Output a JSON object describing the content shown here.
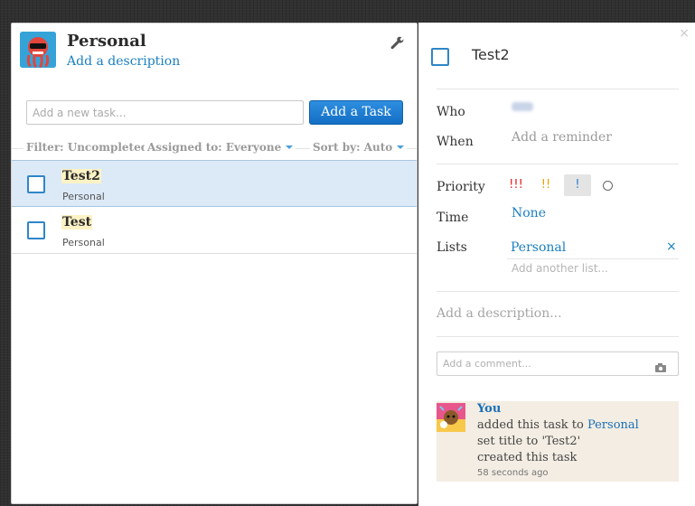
{
  "list": {
    "title": "Personal",
    "description_link": "Add a description",
    "new_task_placeholder": "Add a new task...",
    "add_task_label": "Add a Task"
  },
  "filters": {
    "filter": "Filter: Uncompleted",
    "assigned": "Assigned to: Everyone",
    "sort": "Sort by: Auto"
  },
  "tasks": [
    {
      "title": "Test2",
      "list": "Personal",
      "selected": true
    },
    {
      "title": "Test",
      "list": "Personal",
      "selected": false
    }
  ],
  "detail": {
    "title": "Test2",
    "close": "×",
    "who_label": "Who",
    "when_label": "When",
    "when_value": "Add a reminder",
    "priority_label": "Priority",
    "priority_options": [
      "!!!",
      "!!",
      "!"
    ],
    "priority_selected": "!",
    "time_label": "Time",
    "time_value": "None",
    "lists_label": "Lists",
    "list_value": "Personal",
    "remove_list": "×",
    "add_list_placeholder": "Add another list...",
    "description_placeholder": "Add a description...",
    "comment_placeholder": "Add a comment..."
  },
  "activity": {
    "user": "You",
    "line1_prefix": "added this task to ",
    "line1_link": "Personal",
    "line2": "set title to 'Test2'",
    "line3": "created this task",
    "time": "58 seconds ago"
  },
  "colors": {
    "accent": "#1a7fc0",
    "button": "#136fc4",
    "selected_row": "#dce9f7",
    "priority_high": "#e02020",
    "priority_med": "#e8a000",
    "priority_low": "#2a7fd0",
    "activity_bg": "#f3ede3"
  },
  "icons": [
    "wrench-icon",
    "close-icon",
    "camera-icon",
    "checkbox-icon",
    "chevron-down-icon",
    "avatar"
  ]
}
